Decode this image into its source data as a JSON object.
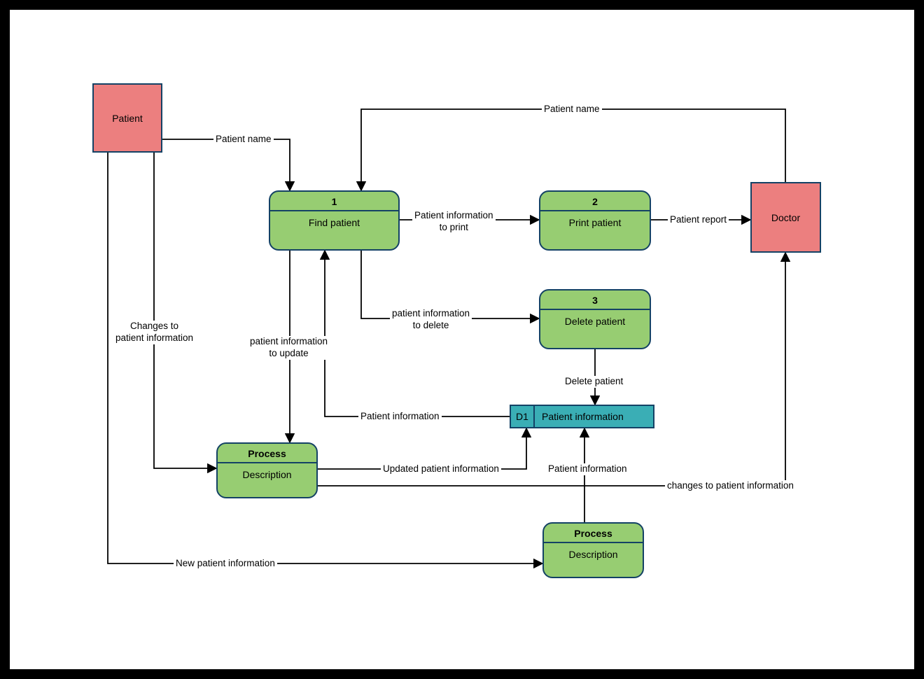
{
  "entities": {
    "patient": "Patient",
    "doctor": "Doctor"
  },
  "processes": {
    "p1": {
      "num": "1",
      "title": "Find patient"
    },
    "p2": {
      "num": "2",
      "title": "Print patient"
    },
    "p3": {
      "num": "3",
      "title": "Delete patient"
    },
    "p4": {
      "num": "Process",
      "title": "Description"
    },
    "p5": {
      "num": "Process",
      "title": "Description"
    }
  },
  "datastores": {
    "d1": {
      "label": "D1",
      "name": "Patient information"
    }
  },
  "flows": {
    "f1": "Patient name",
    "f2": "Patient name",
    "f3": "Patient information\nto print",
    "f4": "Patient report",
    "f5": "patient information\nto delete",
    "f6": "Delete patient",
    "f7": "Patient information",
    "f8": "patient information\nto update",
    "f9": "Updated patient information",
    "f10": "Patient information",
    "f11": "changes to patient information",
    "f12": "Changes to\npatient information",
    "f13": "New patient information"
  }
}
